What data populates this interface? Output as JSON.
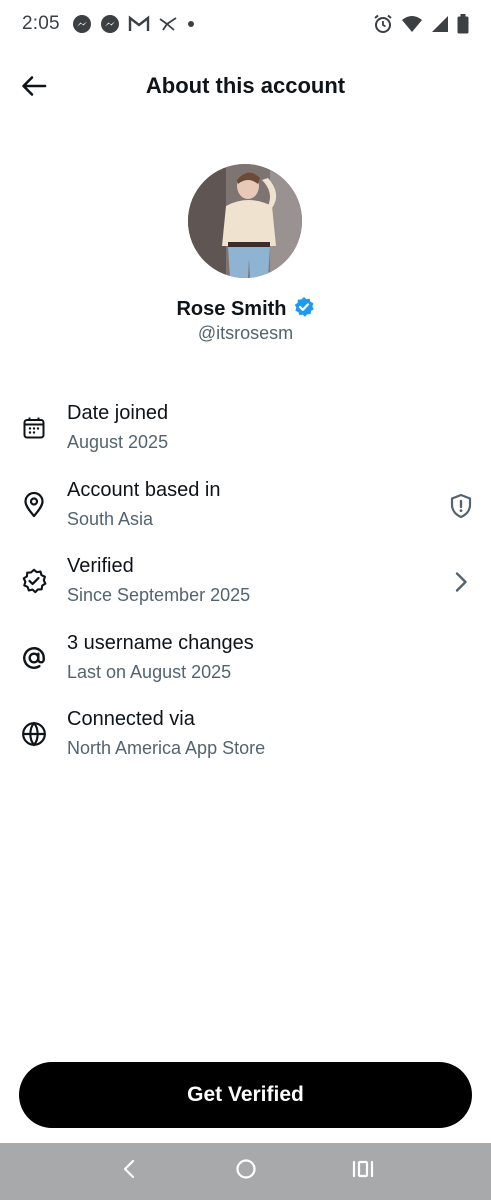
{
  "status_bar": {
    "time": "2:05",
    "left_icons": [
      "messenger-icon",
      "messenger-icon",
      "gmail-icon",
      "twitter-icon",
      "dot-icon"
    ],
    "right_icons": [
      "alarm-icon",
      "wifi-icon",
      "signal-icon",
      "battery-icon"
    ]
  },
  "header": {
    "title": "About this account",
    "back_icon": "arrow-left-icon"
  },
  "profile": {
    "display_name": "Rose Smith",
    "username": "@itsrosesm",
    "verified_badge_color": "#1d9bf0"
  },
  "info_rows": [
    {
      "icon": "calendar-icon",
      "title": "Date joined",
      "subtitle": "August 2025"
    },
    {
      "icon": "location-pin-icon",
      "title": "Account based in",
      "subtitle": "South Asia",
      "trailing": "shield-alert-icon"
    },
    {
      "icon": "verified-badge-icon",
      "title": "Verified",
      "subtitle": "Since September 2025",
      "trailing": "chevron-right-icon"
    },
    {
      "icon": "at-sign-icon",
      "title": "3 username changes",
      "subtitle": "Last on August 2025"
    },
    {
      "icon": "globe-icon",
      "title": "Connected via",
      "subtitle": "North America App Store"
    }
  ],
  "cta": {
    "label": "Get Verified"
  },
  "nav_bar": {
    "buttons": [
      "back-triangle-icon",
      "home-circle-icon",
      "recents-icon"
    ]
  },
  "colors": {
    "text_primary": "#0f1419",
    "text_secondary": "#536471",
    "accent": "#1d9bf0",
    "button_bg": "#000000",
    "nav_bg": "#a8a9ab"
  }
}
